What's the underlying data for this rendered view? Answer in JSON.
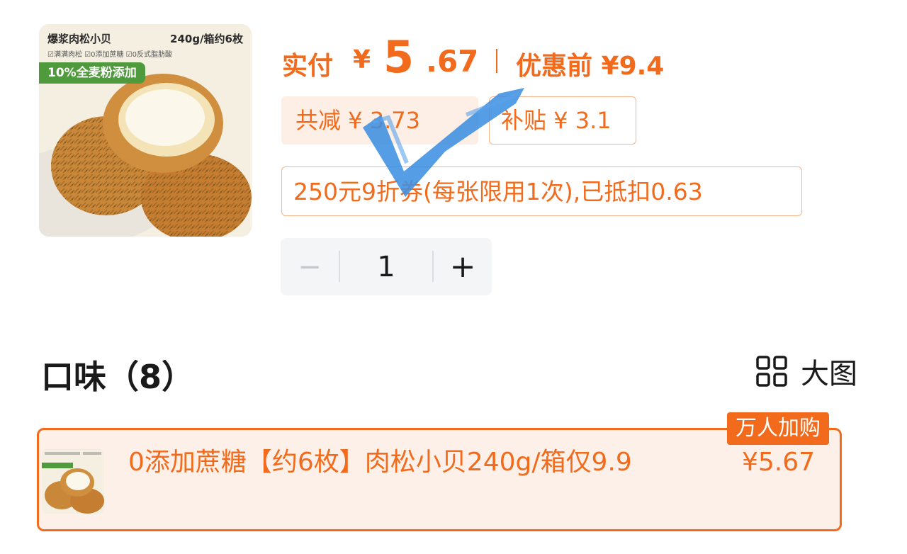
{
  "product": {
    "image": {
      "title": "爆浆肉松小贝",
      "spec": "240g/箱约6枚",
      "claims": "☑满满肉松 ☑0添加蔗糖 ☑0反式脂肪酸",
      "banner": "10%全麦粉添加"
    }
  },
  "price": {
    "paid_label": "实付",
    "currency": "¥",
    "paid_int": "5",
    "paid_dec": ".67",
    "orig_label": "优惠前 ¥9.4"
  },
  "chips": {
    "total_reduction": "共减 ¥ 3.73",
    "subsidy": "补贴 ¥ 3.1",
    "coupon": "250元9折券(每张限用1次),已抵扣0.63"
  },
  "stepper": {
    "minus": "−",
    "quantity": "1",
    "plus": "+"
  },
  "flavor": {
    "title": "口味（8）",
    "large_view_label": "大图"
  },
  "option": {
    "label": "0添加蔗糖【约6枚】肉松小贝240g/箱仅9.9",
    "price": "¥5.67",
    "badge": "万人加购"
  },
  "colors": {
    "accent": "#f26b1d",
    "chip_bg": "#fdeee6",
    "chip_border": "#f6b58c",
    "check_blue": "#3d8fe0",
    "stepper_bg": "#f4f5f7"
  }
}
